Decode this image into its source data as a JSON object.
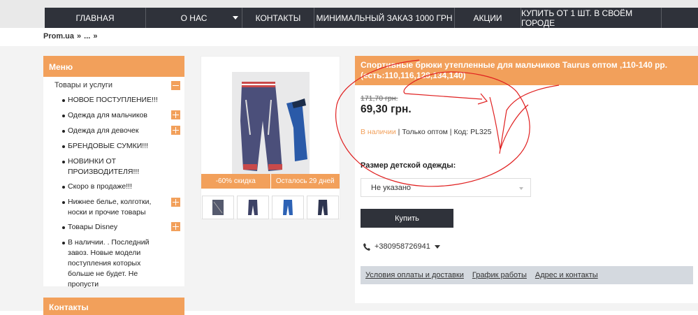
{
  "nav": {
    "items": [
      "ГЛАВНАЯ",
      "О НАС",
      "КОНТАКТЫ",
      "МИНИМАЛЬНЫЙ ЗАКАЗ 1000 ГРН",
      "АКЦИИ",
      "КУПИТЬ ОТ 1 ШТ. В СВОЁМ ГОРОДЕ"
    ]
  },
  "breadcrumb": {
    "root": "Prom.ua",
    "sep1": "»",
    "more": "...",
    "sep2": "»"
  },
  "sidebar": {
    "title": "Меню",
    "root_label": "Товары и услуги",
    "items": [
      {
        "label": "НОВОЕ ПОСТУПЛЕНИЕ!!!",
        "expandable": false
      },
      {
        "label": "Одежда для мальчиков",
        "expandable": true
      },
      {
        "label": "Одежда для девочек",
        "expandable": true
      },
      {
        "label": "БРЕНДОВЫЕ СУМКИ!!!",
        "expandable": false
      },
      {
        "label": "НОВИНКИ ОТ ПРОИЗВОДИТЕЛЯ!!!",
        "expandable": false
      },
      {
        "label": "Скоро в продаже!!!",
        "expandable": false
      },
      {
        "label": "Нижнее белье, колготки, носки и прочие товары",
        "expandable": true
      },
      {
        "label": "Товары Disney",
        "expandable": true
      },
      {
        "label": "В наличии. . Последний завоз. Новые модели поступления которых больше не будет. Не пропусти",
        "expandable": false
      }
    ],
    "contacts_title": "Контакты"
  },
  "gallery": {
    "discount_badge": "-60% скидка",
    "remaining_badge": "Осталось 29 дней"
  },
  "product": {
    "title": "Спортивные брюки утепленные для мальчиков Taurus оптом ,110-140 рр. (есть:110,116,128,134,140)",
    "old_price": "171,70 грн.",
    "price": "69,30 грн.",
    "availability": "В наличии",
    "wholesale": "Только оптом",
    "code": "Код: PL325",
    "size_label": "Размер детской одежды:",
    "size_value": "Не указано",
    "buy_label": "Купить",
    "phone": "+380958726941"
  },
  "links": [
    "Условия оплаты и доставки",
    "График работы",
    "Адрес и контакты"
  ],
  "colors": {
    "accent": "#f2a05b",
    "dark": "#2f323a",
    "annotation": "#e02020"
  }
}
